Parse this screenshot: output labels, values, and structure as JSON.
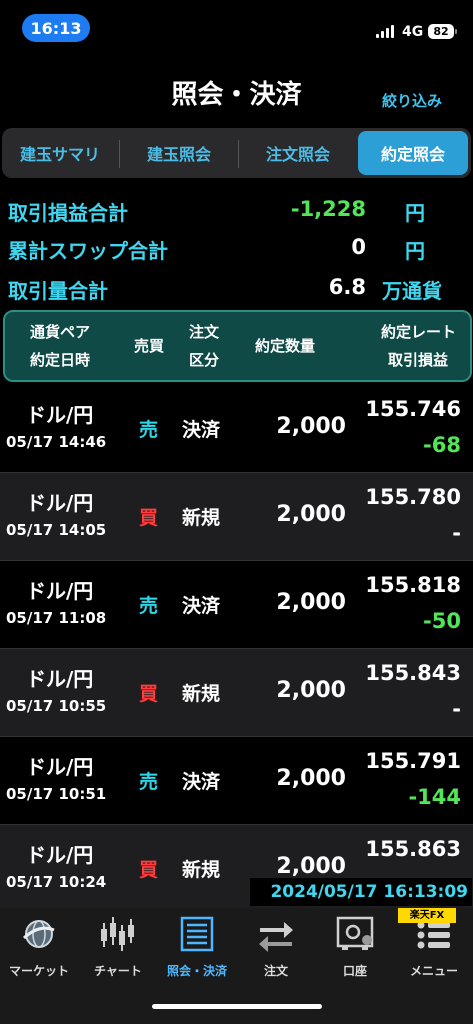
{
  "status_bar": {
    "time": "16:13",
    "network": "4G",
    "battery": "82"
  },
  "header": {
    "title": "照会・決済",
    "filter_label": "絞り込み"
  },
  "tabs": [
    {
      "label": "建玉サマリ",
      "active": false
    },
    {
      "label": "建玉照会",
      "active": false
    },
    {
      "label": "注文照会",
      "active": false
    },
    {
      "label": "約定照会",
      "active": true
    }
  ],
  "summary": {
    "pnl_label": "取引損益合計",
    "pnl_value": "-1,228",
    "pnl_unit": "円",
    "swap_label": "累計スワップ合計",
    "swap_value": "0",
    "swap_unit": "円",
    "volume_label": "取引量合計",
    "volume_value": "6.8",
    "volume_unit": "万通貨"
  },
  "columns": {
    "pair": "通貨ペア",
    "date": "約定日時",
    "side": "売買",
    "type_1": "注文",
    "type_2": "区分",
    "quantity": "約定数量",
    "rate": "約定レート",
    "pnl": "取引損益"
  },
  "trades": [
    {
      "pair": "ドル/円",
      "datetime": "05/17 14:46",
      "side": "売",
      "type": "決済",
      "quantity": "2,000",
      "rate": "155.746",
      "pnl": "-68"
    },
    {
      "pair": "ドル/円",
      "datetime": "05/17 14:05",
      "side": "買",
      "type": "新規",
      "quantity": "2,000",
      "rate": "155.780",
      "pnl": "-"
    },
    {
      "pair": "ドル/円",
      "datetime": "05/17 11:08",
      "side": "売",
      "type": "決済",
      "quantity": "2,000",
      "rate": "155.818",
      "pnl": "-50"
    },
    {
      "pair": "ドル/円",
      "datetime": "05/17 10:55",
      "side": "買",
      "type": "新規",
      "quantity": "2,000",
      "rate": "155.843",
      "pnl": "-"
    },
    {
      "pair": "ドル/円",
      "datetime": "05/17 10:51",
      "side": "売",
      "type": "決済",
      "quantity": "2,000",
      "rate": "155.791",
      "pnl": "-144"
    },
    {
      "pair": "ドル/円",
      "datetime": "05/17 10:24",
      "side": "買",
      "type": "新規",
      "quantity": "2,000",
      "rate": "155.863",
      "pnl": ""
    }
  ],
  "timestamp": "2024/05/17 16:13:09",
  "brand": "楽天FX",
  "nav": [
    {
      "label": "マーケット",
      "icon": "globe-icon",
      "active": false
    },
    {
      "label": "チャート",
      "icon": "candlestick-icon",
      "active": false
    },
    {
      "label": "照会・決済",
      "icon": "list-icon",
      "active": true
    },
    {
      "label": "注文",
      "icon": "order-arrows-icon",
      "active": false
    },
    {
      "label": "口座",
      "icon": "safe-icon",
      "active": false
    },
    {
      "label": "メニュー",
      "icon": "menu-icon",
      "active": false
    }
  ],
  "colors": {
    "accent": "#3fd7f0",
    "sell": "#2fd8e8",
    "buy": "#ff3b3b",
    "loss": "#52e55a",
    "tab_active": "#2b9fd6",
    "header_box": "#0f4a47"
  }
}
